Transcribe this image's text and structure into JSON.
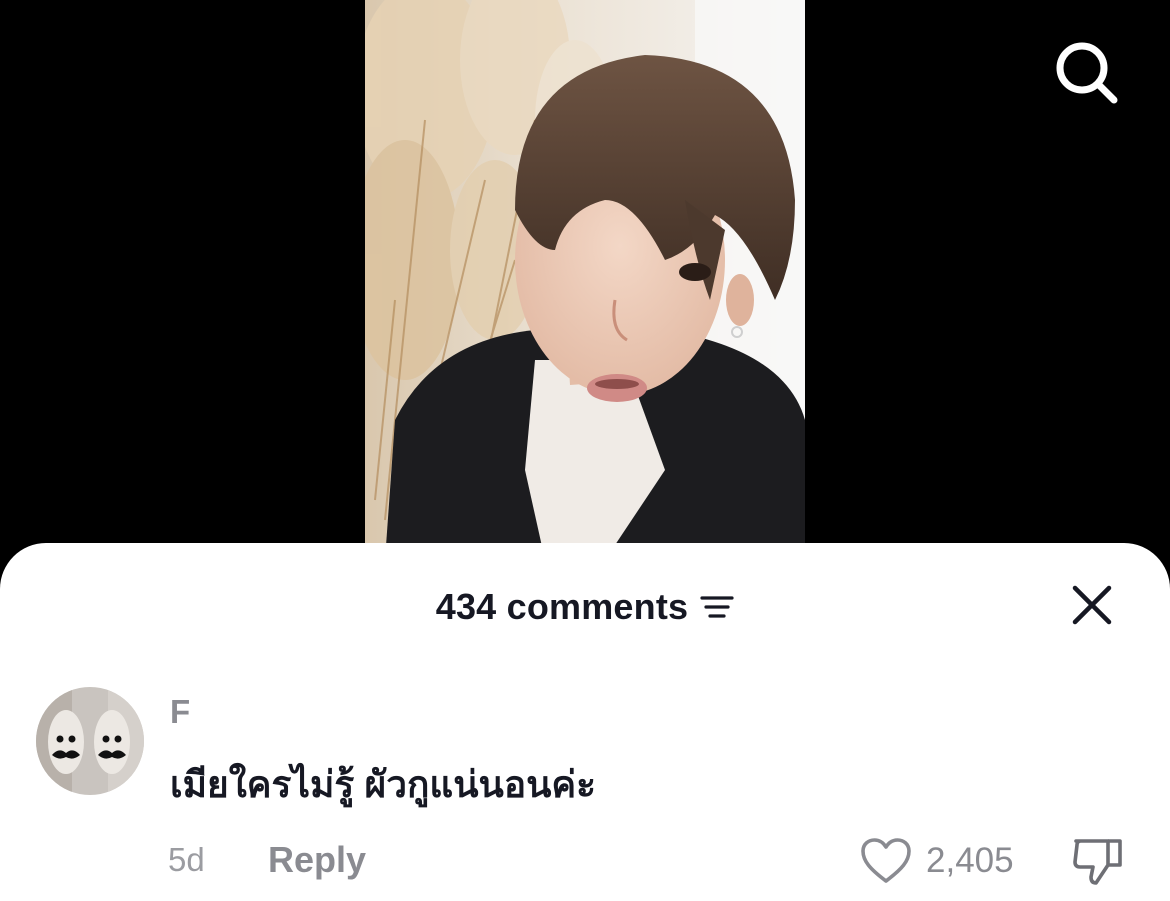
{
  "video": {
    "description_icon": "video-frame"
  },
  "top_bar": {
    "search_icon": "search-icon"
  },
  "comments_sheet": {
    "count_label": "434 comments",
    "sort_icon": "sort-icon",
    "close_icon": "close-icon"
  },
  "comment": {
    "username": "F",
    "text": "เมียใครไม่รู้ ผัวกูแน่นอนค่ะ",
    "time": "5d",
    "reply_label": "Reply",
    "like_icon": "heart-icon",
    "like_count": "2,405",
    "dislike_icon": "thumbs-down-icon"
  },
  "colors": {
    "primary_text": "#161823",
    "secondary_text": "#8a8b91",
    "sheet_background": "#ffffff",
    "page_background": "#000000"
  }
}
